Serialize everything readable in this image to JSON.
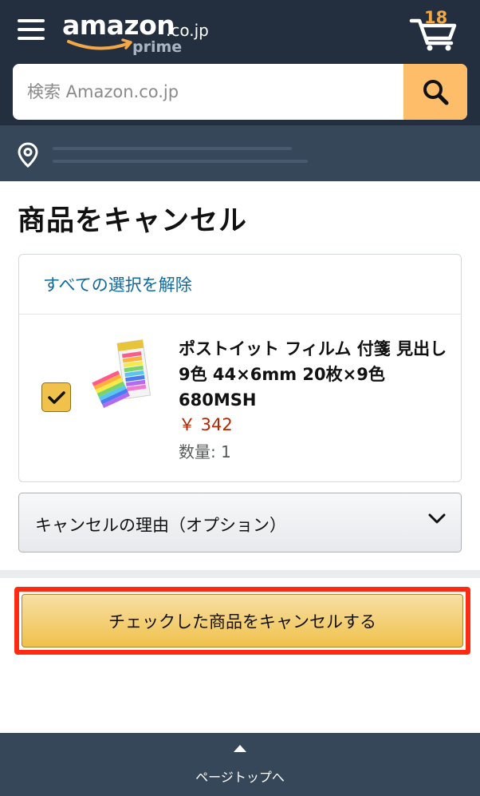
{
  "header": {
    "logo_word": "amazon",
    "logo_suffix": ".co.jp",
    "logo_sub": "prime",
    "cart_count": "18",
    "menu_icon": "hamburger-menu-icon",
    "cart_icon": "cart-icon"
  },
  "search": {
    "placeholder": "検索 Amazon.co.jp",
    "button_icon": "search-icon"
  },
  "location": {
    "icon": "location-pin-icon"
  },
  "page": {
    "title": "商品をキャンセル"
  },
  "order_card": {
    "deselect_all": "すべての選択を解除",
    "item": {
      "checked": true,
      "title": "ポストイット フィルム 付箋 見出し 9色 44×6mm 20枚×9色 680MSH",
      "price": "￥ 342",
      "quantity": "数量: 1"
    }
  },
  "reason_dropdown": {
    "label": "キャンセルの理由（オプション）",
    "icon": "chevron-down-icon"
  },
  "submit": {
    "label": "チェックした商品をキャンセルする"
  },
  "footer": {
    "back_to_top": "ページトップへ",
    "icon": "caret-up-icon"
  },
  "colors": {
    "header_bg": "#232f3e",
    "subheader_bg": "#37475a",
    "search_button": "#febd69",
    "link": "#0f6a9c",
    "price": "#b12704",
    "highlight_border": "#ff2a12",
    "cart_count": "#f3a847"
  }
}
